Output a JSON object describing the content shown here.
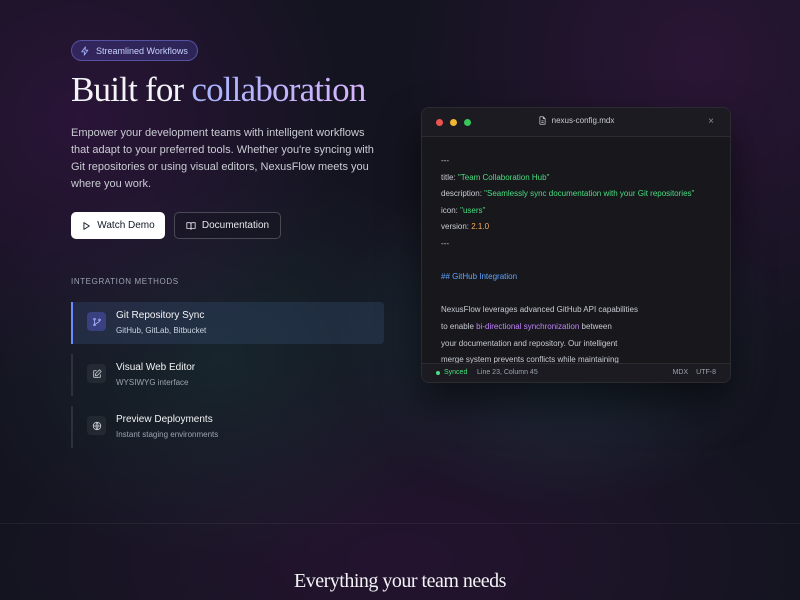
{
  "badge": {
    "icon": "lightning-icon",
    "label": "Streamlined Workflows"
  },
  "hero": {
    "title_plain": "Built for ",
    "title_accent": "collaboration",
    "description": "Empower your development teams with intelligent workflows that adapt to your preferred tools. Whether you're syncing with Git repositories or using visual editors, NexusFlow meets you where you work."
  },
  "buttons": {
    "watch_demo": "Watch Demo",
    "documentation": "Documentation"
  },
  "integration": {
    "label": "INTEGRATION METHODS",
    "items": [
      {
        "title": "Git Repository Sync",
        "subtitle": "GitHub, GitLab, Bitbucket",
        "icon": "git-branch-icon",
        "active": true
      },
      {
        "title": "Visual Web Editor",
        "subtitle": "WYSIWYG interface",
        "icon": "edit-icon",
        "active": false
      },
      {
        "title": "Preview Deployments",
        "subtitle": "Instant staging environments",
        "icon": "globe-icon",
        "active": false
      }
    ]
  },
  "editor": {
    "filename": "nexus-config.mdx",
    "close": "×",
    "code": {
      "fence_open": "---",
      "title_key": "title: ",
      "title_val": "\"Team Collaboration Hub\"",
      "desc_key": "description: ",
      "desc_val": "\"Seamlessly sync documentation with your Git repositories\"",
      "icon_key": "icon: ",
      "icon_val": "\"users\"",
      "version_key": "version: ",
      "version_val": "2.1.0",
      "fence_close": "---",
      "heading": "## GitHub Integration",
      "p1": "NexusFlow leverages advanced GitHub API capabilities",
      "p2_pre": "to enable ",
      "p2_hl": "bi-directional synchronization",
      "p2_post": " between",
      "p3": "your documentation and repository. Our intelligent",
      "p4": "merge system prevents conflicts while maintaining"
    },
    "status": {
      "sync": "Synced",
      "position": "Line 23, Column 45",
      "lang": "MDX",
      "encoding": "UTF-8"
    }
  },
  "next_section": {
    "title": "Everything your team needs"
  },
  "colors": {
    "accent": "#6b8cff",
    "string": "#4ade80",
    "number": "#f6ad55",
    "heading": "#60a5fa",
    "highlight": "#c084fc"
  }
}
